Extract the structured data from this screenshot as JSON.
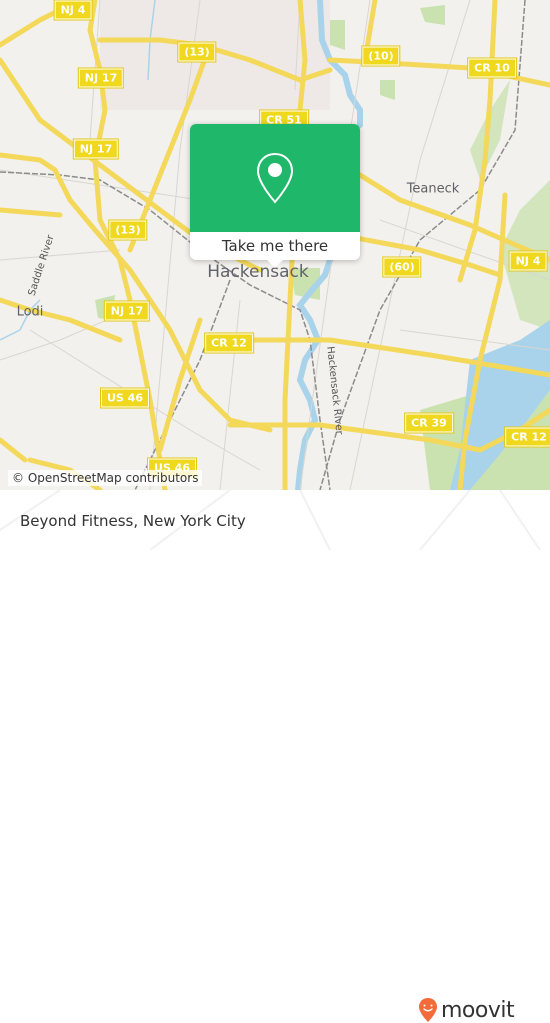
{
  "map": {
    "attribution": "© OpenStreetMap contributors",
    "colors": {
      "background": "#f2f1ed",
      "road": "#f7e06e",
      "water": "#a9d3ea",
      "park": "#c9e2b0",
      "rail": "#8b8b8b",
      "shield": "#efd81d"
    },
    "places": [
      {
        "name": "Hackensack",
        "size": "big"
      },
      {
        "name": "Teaneck",
        "size": "mid"
      },
      {
        "name": "Lodi",
        "size": "mid"
      }
    ],
    "rivers": [
      {
        "name": "Saddle River"
      },
      {
        "name": "Hackensack River"
      }
    ],
    "shields": [
      {
        "label": "NJ 4"
      },
      {
        "label": "(13)"
      },
      {
        "label": "NJ 17"
      },
      {
        "label": "NJ 17"
      },
      {
        "label": "(10)"
      },
      {
        "label": "CR 10"
      },
      {
        "label": "CR 51"
      },
      {
        "label": "(13)"
      },
      {
        "label": "NJ 17"
      },
      {
        "label": "(60)"
      },
      {
        "label": "NJ 4"
      },
      {
        "label": "CR 12"
      },
      {
        "label": "US 46"
      },
      {
        "label": "CR 39"
      },
      {
        "label": "CR 12"
      },
      {
        "label": "US 46"
      }
    ]
  },
  "popup": {
    "icon": "location-pin-icon",
    "button_label": "Take me there",
    "accent": "#1fb86a"
  },
  "footer": {
    "title": "Beyond Fitness, New York City",
    "brand": "moovit",
    "brand_color": "#f26b3a"
  }
}
